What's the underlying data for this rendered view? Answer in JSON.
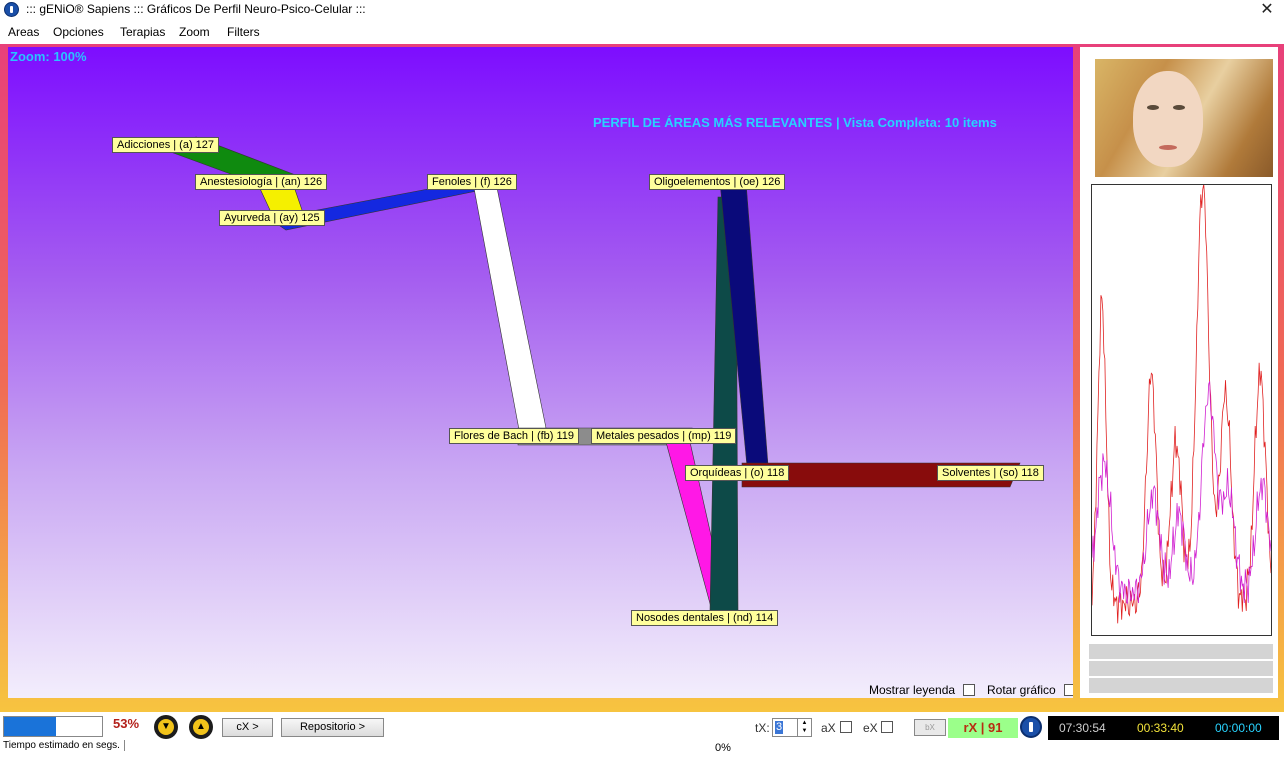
{
  "window": {
    "title": "::: gENiO® Sapiens ::: Gráficos De Perfil Neuro-Psico-Celular :::",
    "close_symbol": "✕"
  },
  "menu": [
    "Areas",
    "Opciones",
    "Terapias",
    "Zoom",
    "Filters"
  ],
  "plot": {
    "zoom_label": "Zoom: 100%",
    "profile_title": "PERFIL DE ÁREAS MÁS RELEVANTES | Vista Completa: 10 items",
    "nodes": [
      {
        "label": "Adicciones | (a) 127",
        "color": "#0f8a0f"
      },
      {
        "label": "Anestesiología | (an) 126",
        "color": "#f5f000"
      },
      {
        "label": "Ayurveda | (ay) 125",
        "color": "#1428e0"
      },
      {
        "label": "Fenoles | (f) 126",
        "color": "#ffffff"
      },
      {
        "label": "Flores de Bach | (fb) 119",
        "color": "#8c8c8c"
      },
      {
        "label": "Metales pesados | (mp) 119",
        "color": "#ff18e6"
      },
      {
        "label": "Nosodes dentales | (nd) 114",
        "color": "#0d4a48"
      },
      {
        "label": "Oligoelementos | (oe) 126",
        "color": "#0a0a7a"
      },
      {
        "label": "Orquídeas | (o) 118",
        "color": "#880c0c"
      },
      {
        "label": "Solventes | (so) 118",
        "color": "#880c0c"
      }
    ],
    "mostrar_leyenda": "Mostrar leyenda",
    "rotar_grafico": "Rotar gráfico"
  },
  "status": {
    "progress_fraction": 0.53,
    "percent_label": "53%",
    "cx_button": "cX >",
    "repositorio_button": "Repositorio >",
    "estimated_time": "Tiempo estimado en segs.",
    "bottom_percent": "0%",
    "tx_label": "tX:",
    "tx_value": "3",
    "ax_label": "aX",
    "ex_label": "eX",
    "bx_button": "bX",
    "rx_value": "rX | 91",
    "clock1": "07:30:54",
    "clock2": "00:33:40",
    "clock3": "00:00:00",
    "clock1_color": "#cfcfcf",
    "clock2_color": "#f2e23a",
    "clock3_color": "#29d4ff"
  },
  "icons": {
    "app": "info-icon",
    "down_button": "scroll-down-icon",
    "up_button": "eject-up-icon"
  }
}
